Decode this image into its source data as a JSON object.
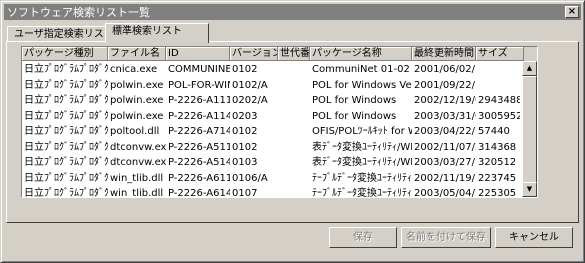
{
  "window": {
    "title": "ソフトウェア検索リスト一覧",
    "close_label": "×"
  },
  "tabs": [
    {
      "label": "ユーザ指定検索リスト"
    },
    {
      "label": "標準検索リスト"
    }
  ],
  "table": {
    "columns": [
      "パッケージ種別",
      "ファイル名",
      "ID",
      "バージョン",
      "世代番号",
      "パッケージ名称",
      "最終更新時間日",
      "サイズ"
    ],
    "rows": [
      [
        "日立ﾌﾟﾛｸﾞﾗﾑﾌﾟﾛﾀﾞｸﾄ",
        "cnica.exe",
        "COMMUNINET",
        "0102",
        "",
        "CommuniNet 01-02",
        "2001/06/02/10",
        ""
      ],
      [
        "日立ﾌﾟﾛｸﾞﾗﾑﾌﾟﾛﾀﾞｸﾄ",
        "polwin.exe",
        "POL-FOR-WINI",
        "0102/A",
        "",
        "POL for Windows Ver.01~I",
        "2001/09/22/11",
        ""
      ],
      [
        "日立ﾌﾟﾛｸﾞﾗﾑﾌﾟﾛﾀﾞｸﾄ",
        "polwin.exe",
        "P-2226-A111",
        "0202/A",
        "",
        "POL for Windows",
        "2002/12/19/02",
        "2943488"
      ],
      [
        "日立ﾌﾟﾛｸﾞﾗﾑﾌﾟﾛﾀﾞｸﾄ",
        "polwin.exe",
        "P-2226-A114",
        "0203",
        "",
        "POL for Windows",
        "2003/03/31/02",
        "3005952"
      ],
      [
        "日立ﾌﾟﾛｸﾞﾗﾑﾌﾟﾛﾀﾞｸﾄ",
        "poltool.dll",
        "P-2226-A714",
        "0102",
        "",
        "OFIS/POLﾂｰﾙｷｯﾄ for Wi",
        "2003/04/22/19",
        "57440"
      ],
      [
        "日立ﾌﾟﾛｸﾞﾗﾑﾌﾟﾛﾀﾞｸﾄ",
        "dtconvw.exe",
        "P-2226-A511",
        "0102",
        "",
        "表ﾃﾞｰﾀ変換ﾕｰﾃｨﾘﾃｨ/WN",
        "2002/11/07/20",
        "314368"
      ],
      [
        "日立ﾌﾟﾛｸﾞﾗﾑﾌﾟﾛﾀﾞｸﾄ",
        "dtconvw.exe",
        "P-2226-A514",
        "0103",
        "",
        "表ﾃﾞｰﾀ変換ﾕｰﾃｨﾘﾃｨ/WN",
        "2003/03/27/17",
        "320512"
      ],
      [
        "日立ﾌﾟﾛｸﾞﾗﾑﾌﾟﾛﾀﾞｸﾄ",
        "win_tlib.dll",
        "P-2226-A611",
        "0106/A",
        "",
        "ﾃｰﾌﾞﾙﾃﾞｰﾀ変換ﾕｰﾃｨﾘﾃｨ/V",
        "2002/11/19/14",
        "223745"
      ],
      [
        "日立ﾌﾟﾛｸﾞﾗﾑﾌﾟﾛﾀﾞｸﾄ",
        "win_tlib.dll",
        "P-2226-A614",
        "0107",
        "",
        "ﾃｰﾌﾞﾙﾃﾞｰﾀ変換ﾕｰﾃｨﾘﾃｨ/V",
        "2003/05/04/21",
        "225305"
      ]
    ]
  },
  "buttons": {
    "save": "保存",
    "save_as": "名前を付けて保存",
    "cancel": "キャンセル"
  }
}
